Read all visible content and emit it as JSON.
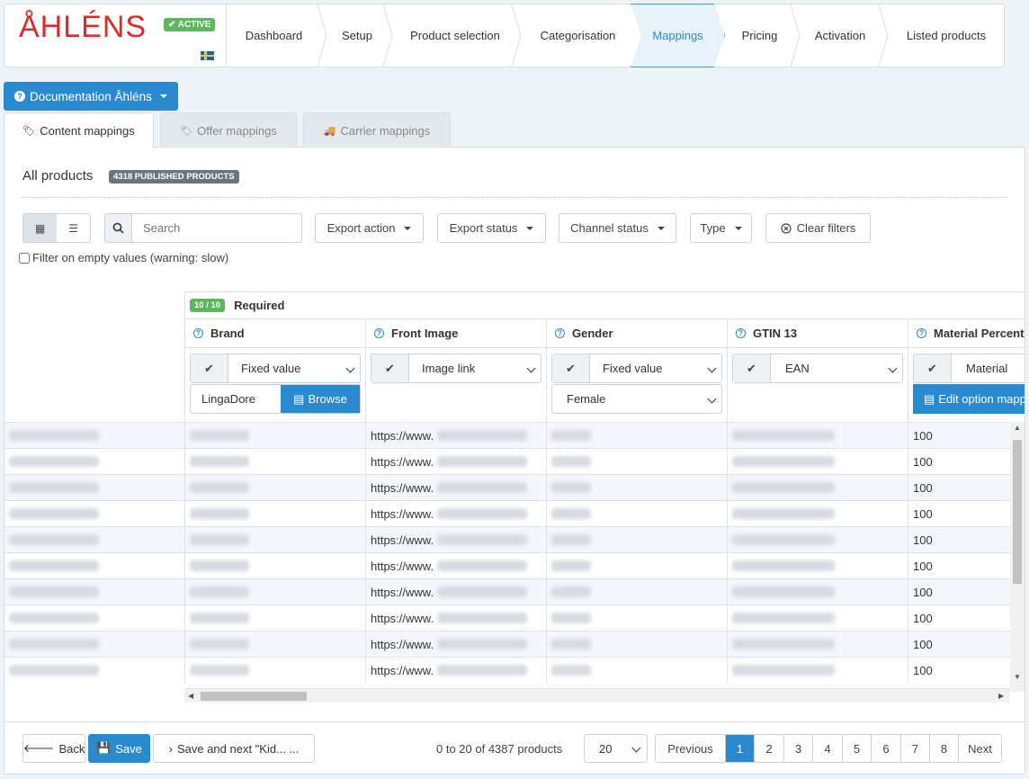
{
  "header": {
    "logo": "ÅHLÉNS",
    "status_badge": "✔ ACTIVE",
    "steps": [
      "Dashboard",
      "Setup",
      "Product selection",
      "Categorisation",
      "Mappings",
      "Pricing",
      "Activation",
      "Listed products"
    ],
    "active_step": "Mappings"
  },
  "documentation_button": "Documentation Åhléns",
  "tabs": [
    "Content mappings",
    "Offer mappings",
    "Carrier mappings"
  ],
  "panel": {
    "title": "All products",
    "published_badge": "4318 PUBLISHED PRODUCTS"
  },
  "toolbar": {
    "search_placeholder": "Search",
    "filters": [
      "Export action",
      "Export status",
      "Channel status",
      "Type"
    ],
    "clear_filters": "Clear filters",
    "empty_filter_label": "Filter on empty values (warning: slow)"
  },
  "grid": {
    "required_badge": "10 / 10",
    "required_label": "Required",
    "columns": [
      {
        "header": "Brand",
        "mapping": "Fixed value",
        "value": "LingaDore",
        "browse": "Browse"
      },
      {
        "header": "Front Image",
        "mapping": "Image link"
      },
      {
        "header": "Gender",
        "mapping": "Fixed value",
        "value": "Female"
      },
      {
        "header": "GTIN 13",
        "mapping": "EAN"
      },
      {
        "header": "Material Percent",
        "mapping": "Material",
        "edit": "Edit option mappings"
      }
    ],
    "row_image_prefix": "https://www.",
    "row_material_value": "100"
  },
  "footer": {
    "back": "Back",
    "save": "Save",
    "save_next": "Save and next \"Kid... ...",
    "count": "0 to 20 of 4387 products",
    "per_page": "20",
    "pages": [
      "Previous",
      "1",
      "2",
      "3",
      "4",
      "5",
      "6",
      "7",
      "8",
      "Next"
    ],
    "current_page": "1"
  },
  "colors": {
    "primary": "#2a8ad0",
    "success": "#5cb85c",
    "logo_red": "#e02a2a"
  }
}
